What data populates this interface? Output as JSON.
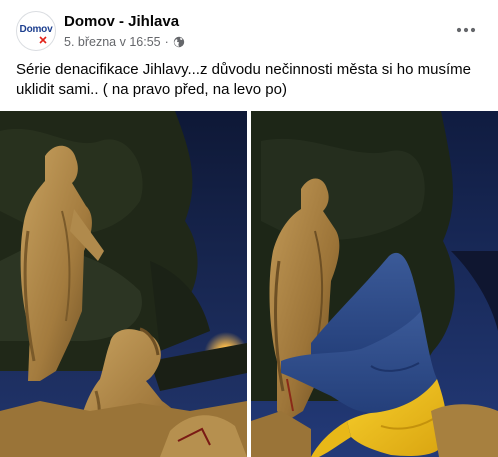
{
  "post": {
    "page_name": "Domov - Jihlava",
    "avatar_text": "Domov",
    "date": "5. března v 16:55",
    "separator": "·",
    "text_line1": "Série denacifikace Jihlavy...z důvodu nečinnosti města si ho musíme",
    "text_line2": "uklidit sami.. ( na pravo před, na levo po)"
  },
  "icons": {
    "privacy": "globe-icon",
    "more": "more-icon"
  },
  "colors": {
    "text_primary": "#050505",
    "text_secondary": "#65676b",
    "brand_blue": "#1d3f8f",
    "brand_red": "#e2231a",
    "flag_blue": "#2e4f8e",
    "flag_yellow": "#f0c419"
  }
}
